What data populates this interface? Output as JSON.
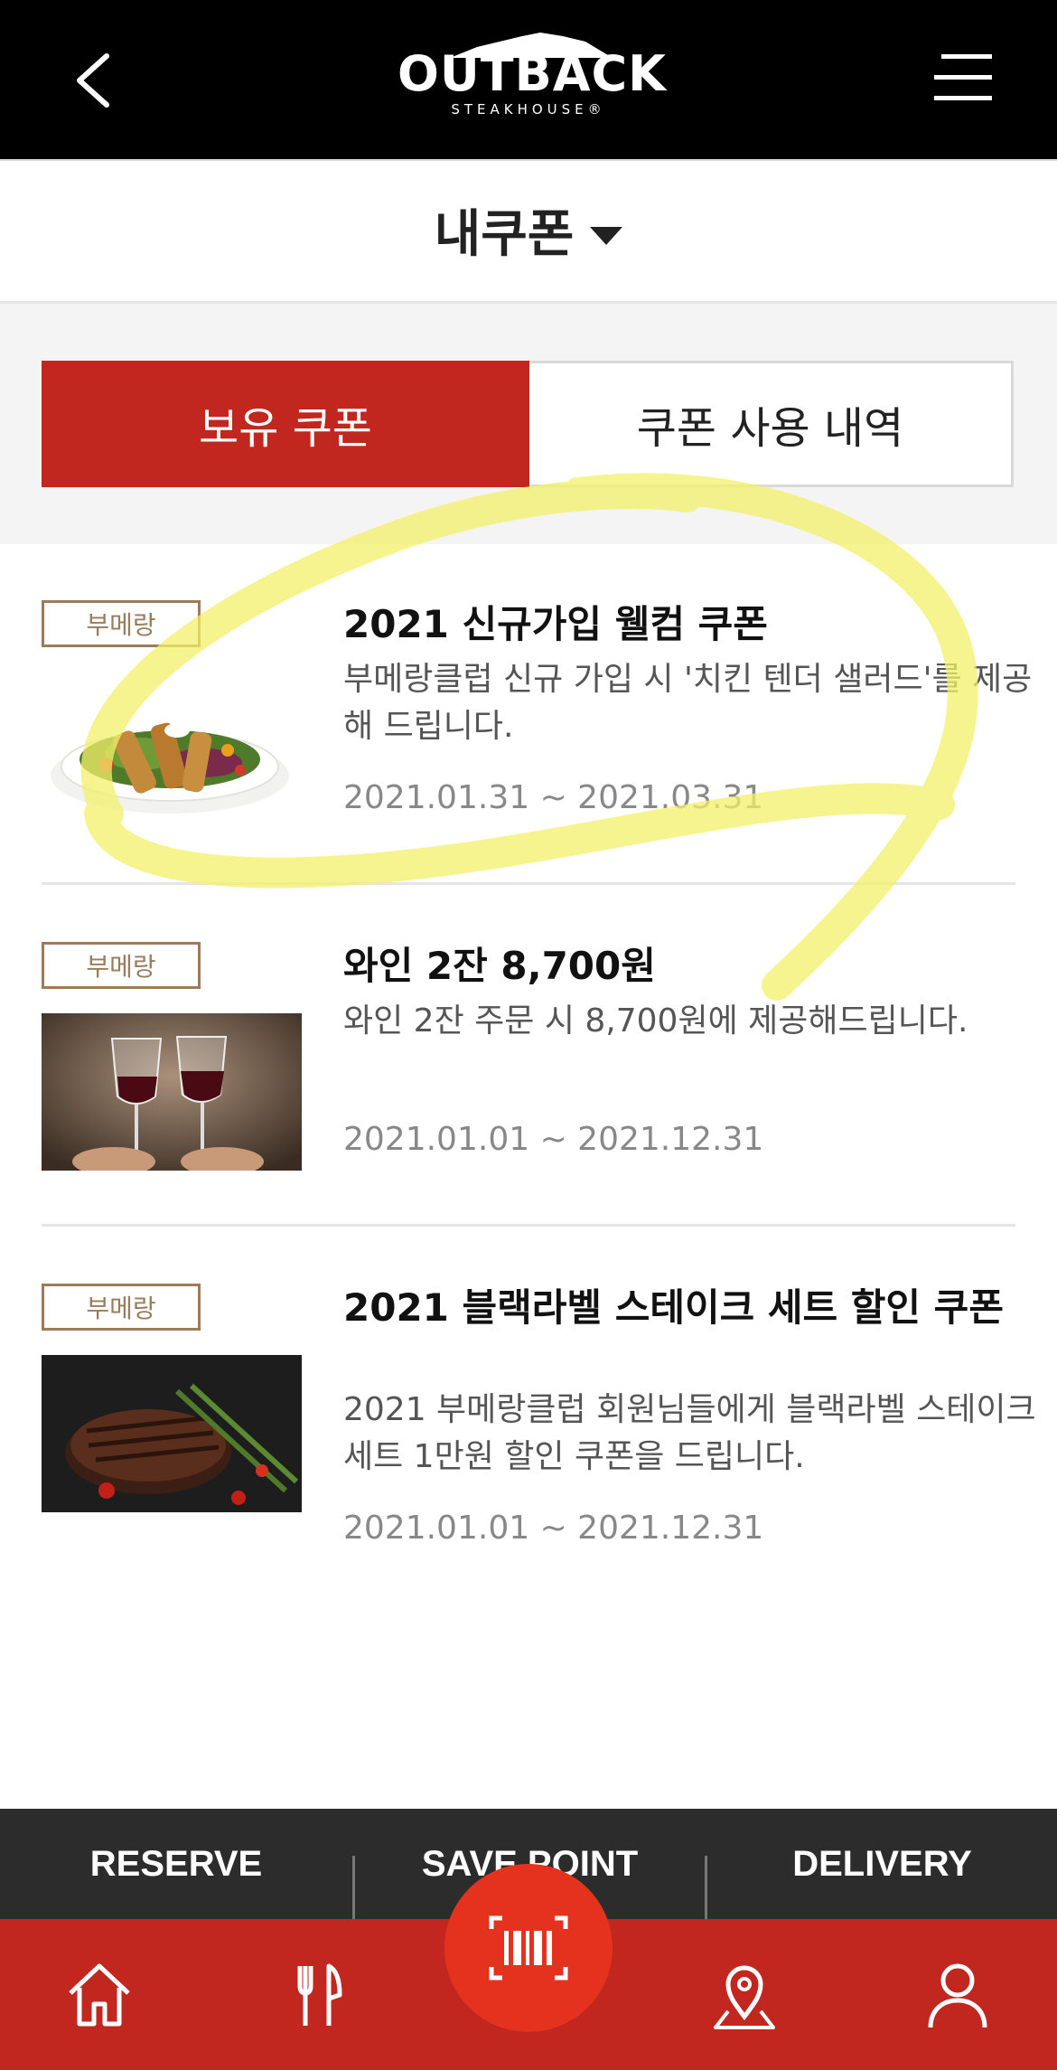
{
  "header": {
    "logo_main": "OUTBACK",
    "logo_sub": "STEAKHOUSE®"
  },
  "page": {
    "title": "내쿠폰"
  },
  "tabs": [
    {
      "label": "보유 쿠폰",
      "active": true
    },
    {
      "label": "쿠폰 사용 내역",
      "active": false
    }
  ],
  "coupons": [
    {
      "badge": "부메랑",
      "title": "2021 신규가입 웰컴 쿠폰",
      "description": "부메랑클럽 신규 가입 시 '치킨 텐더 샐러드'를 제공해 드립니다.",
      "period": "2021.01.31 ~ 2021.03.31",
      "image": "chicken-tender-salad"
    },
    {
      "badge": "부메랑",
      "title": "와인 2잔 8,700원",
      "description": "와인 2잔 주문 시 8,700원에 제공해드립니다.",
      "period": "2021.01.01 ~ 2021.12.31",
      "image": "wine-toast"
    },
    {
      "badge": "부메랑",
      "title": "2021 블랙라벨 스테이크 세트 할인 쿠폰",
      "description": "2021 부메랑클럽 회원님들에게 블랙라벨 스테이크 세트 1만원 할인 쿠폰을 드립니다.",
      "period": "2021.01.01 ~ 2021.12.31",
      "image": "steak-asparagus"
    }
  ],
  "quick_bar": {
    "reserve": "RESERVE",
    "save_point": "SAVE POINT",
    "delivery": "DELIVERY"
  },
  "bottom_nav": [
    "home-icon",
    "menu-fork-knife-icon",
    "barcode-scan-icon",
    "location-pin-icon",
    "user-icon"
  ],
  "colors": {
    "brand_red": "#c1261f",
    "scan_red": "#e4321f",
    "badge_brown": "#9a7b5a",
    "highlight_yellow": "#f3f06a"
  }
}
